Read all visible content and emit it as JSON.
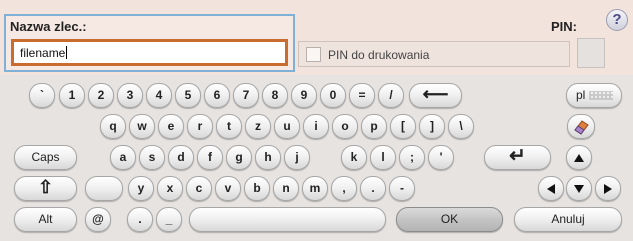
{
  "name_field": {
    "label": "Nazwa zlec.:",
    "value": "filename"
  },
  "pin": {
    "checkbox_label": "PIN do drukowania",
    "label": "PIN:",
    "value": ""
  },
  "help": {
    "glyph": "?"
  },
  "keyboard": {
    "row1": [
      "`",
      "1",
      "2",
      "3",
      "4",
      "5",
      "6",
      "7",
      "8",
      "9",
      "0",
      "=",
      "/"
    ],
    "row2": [
      "q",
      "w",
      "e",
      "r",
      "t",
      "z",
      "u",
      "i",
      "o",
      "p",
      "[",
      "]",
      "\\"
    ],
    "row3": [
      "a",
      "s",
      "d",
      "f",
      "g",
      "h",
      "j",
      "k",
      "l",
      ";",
      "'"
    ],
    "row4": [
      "",
      "y",
      "x",
      "c",
      "v",
      "b",
      "n",
      "m",
      ",",
      ".",
      "-"
    ],
    "row5": [
      "@",
      ".",
      "_"
    ],
    "caps_label": "Caps",
    "alt_label": "Alt",
    "language_label": "pl",
    "ok_label": "OK",
    "cancel_label": "Anuluj",
    "icons": {
      "backspace": "⟵",
      "enter": "↵",
      "shift": "⇧",
      "clear": "eraser-icon"
    }
  }
}
